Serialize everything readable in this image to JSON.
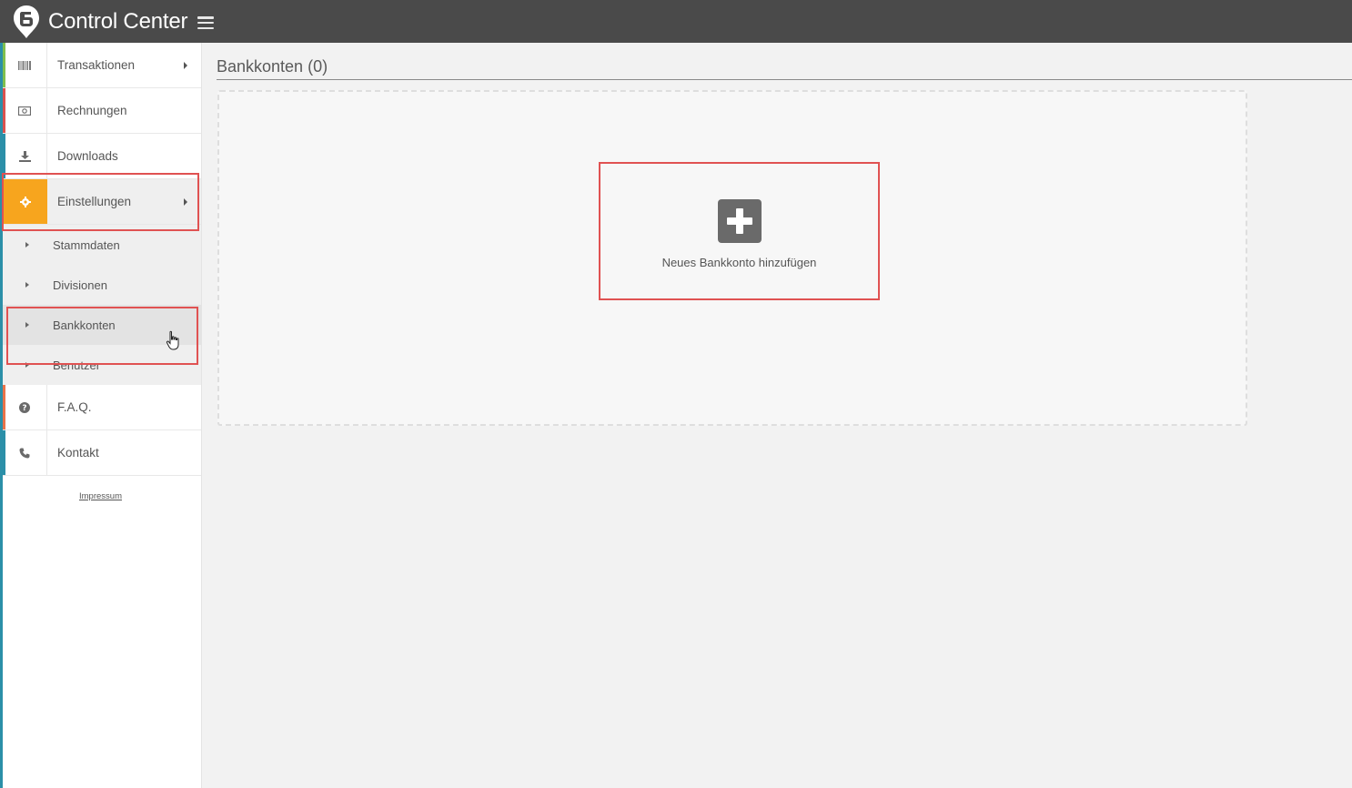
{
  "app": {
    "title": "Control Center"
  },
  "sidebar": {
    "items": [
      {
        "label": "Transaktionen",
        "icon": "barcode-icon",
        "accent": "#7fbf4e",
        "has_children": true
      },
      {
        "label": "Rechnungen",
        "icon": "invoice-icon",
        "accent": "#d9534f",
        "has_children": false
      },
      {
        "label": "Downloads",
        "icon": "download-icon",
        "accent": "#2b8fa8",
        "has_children": false
      },
      {
        "label": "Einstellungen",
        "icon": "gear-icon",
        "accent": "#f7a51e",
        "has_children": true,
        "active": true
      },
      {
        "label": "F.A.Q.",
        "icon": "question-icon",
        "accent": "#e8734a",
        "has_children": false
      },
      {
        "label": "Kontakt",
        "icon": "phone-icon",
        "accent": "#2b8fa8",
        "has_children": false
      }
    ],
    "submenu": [
      {
        "label": "Stammdaten"
      },
      {
        "label": "Divisionen"
      },
      {
        "label": "Bankkonten",
        "hover": true
      },
      {
        "label": "Benutzer"
      }
    ],
    "impressum": "Impressum"
  },
  "main": {
    "title": "Bankkonten (0)",
    "add_button_label": "Neues Bankkonto hinzufügen"
  },
  "colors": {
    "topbar": "#4a4a4a",
    "active_accent": "#f7a51e",
    "highlight": "#e05252"
  }
}
